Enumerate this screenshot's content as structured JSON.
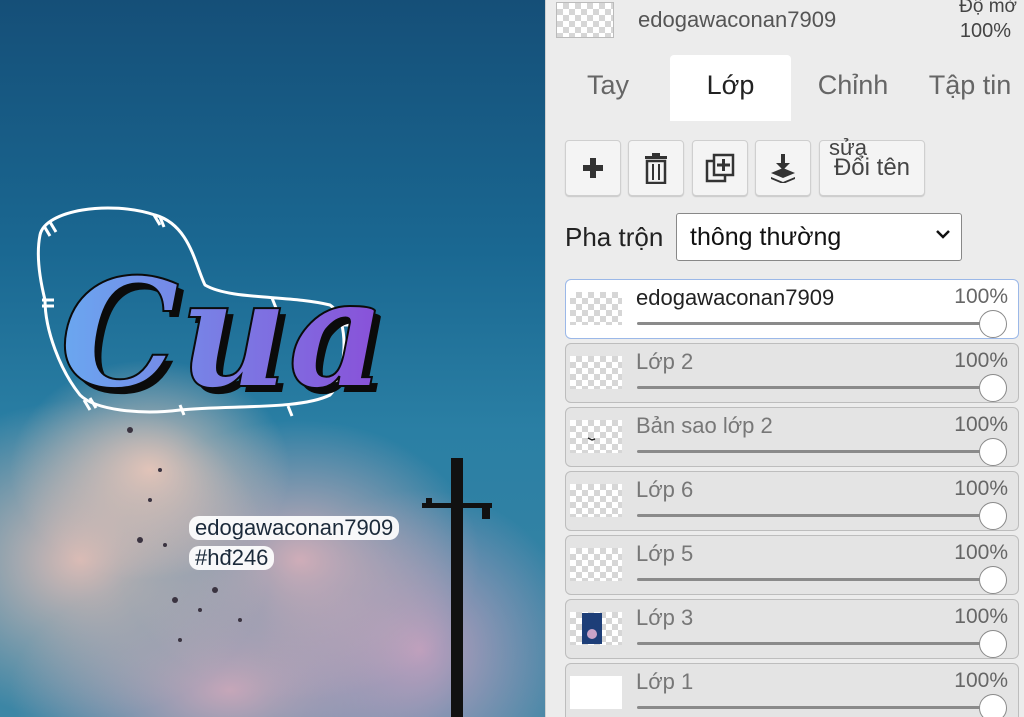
{
  "canvas": {
    "logo_text": "Cua",
    "watermark_line1": "edogawaconan7909",
    "watermark_line2": "#hđ246"
  },
  "header": {
    "current_layer_name": "edogawaconan7909",
    "opacity_label": "Độ mờ",
    "opacity_value": "100%"
  },
  "tabs": [
    {
      "label": "Tay",
      "active": false
    },
    {
      "label": "Lớp",
      "active": true
    },
    {
      "label": "Chỉnh",
      "active": false
    },
    {
      "label": "Tập tin",
      "active": false
    }
  ],
  "toolbar": {
    "add_icon": "plus-icon",
    "delete_icon": "trash-icon",
    "duplicate_icon": "duplicate-icon",
    "merge_icon": "merge-down-icon",
    "rename_label": "Đổi tên",
    "overflow_text": "sửa"
  },
  "blend": {
    "label": "Pha trộn",
    "value": "thông thường"
  },
  "layers": [
    {
      "name": "edogawaconan7909",
      "opacity": "100%",
      "opacity_value": 1.0,
      "active": true,
      "thumb": "checker"
    },
    {
      "name": "Lớp 2",
      "opacity": "100%",
      "opacity_value": 1.0,
      "active": false,
      "thumb": "checker"
    },
    {
      "name": "Bản sao lớp 2",
      "opacity": "100%",
      "opacity_value": 1.0,
      "active": false,
      "thumb": "checker-mark"
    },
    {
      "name": "Lớp 6",
      "opacity": "100%",
      "opacity_value": 1.0,
      "active": false,
      "thumb": "checker"
    },
    {
      "name": "Lớp 5",
      "opacity": "100%",
      "opacity_value": 1.0,
      "active": false,
      "thumb": "checker"
    },
    {
      "name": "Lớp 3",
      "opacity": "100%",
      "opacity_value": 1.0,
      "active": false,
      "thumb": "checker-image"
    },
    {
      "name": "Lớp 1",
      "opacity": "100%",
      "opacity_value": 1.0,
      "active": false,
      "thumb": "white"
    }
  ]
}
